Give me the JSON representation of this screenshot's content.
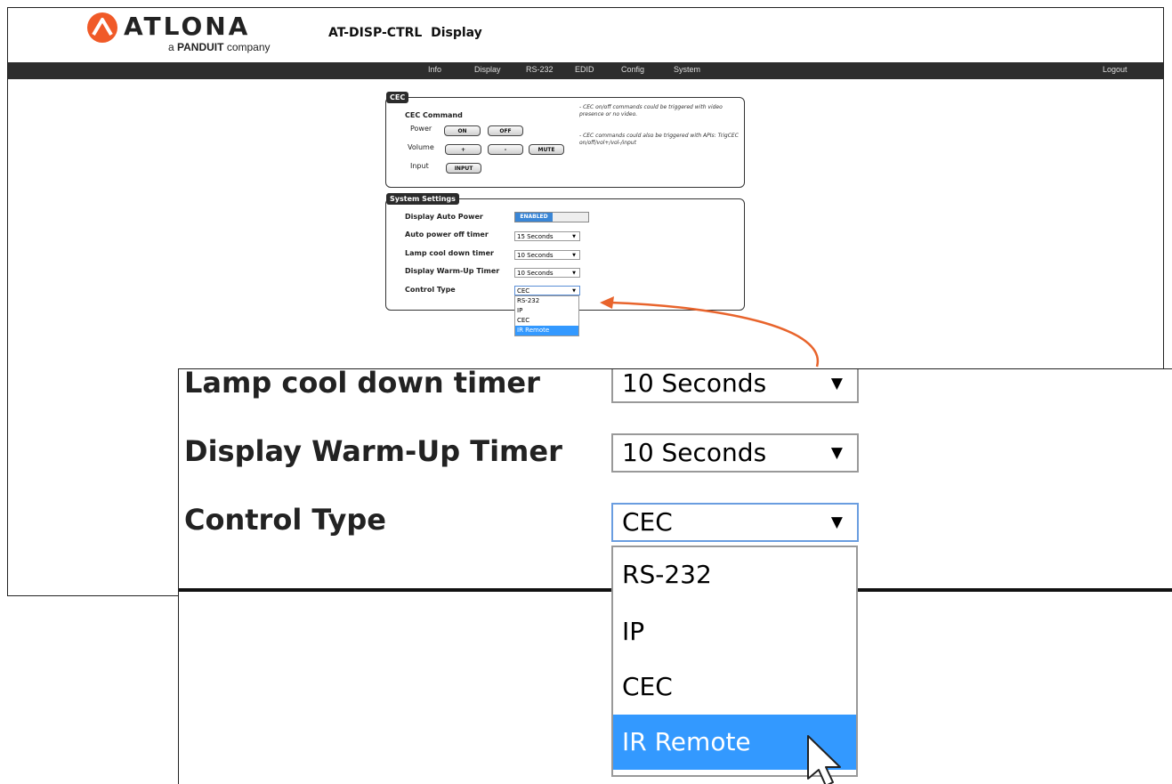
{
  "brand": {
    "logo_text": "ATLONA",
    "tagline_prefix": "a",
    "tagline_brand": "PANDUIT",
    "tagline_suffix": "company"
  },
  "header": {
    "device": "AT-DISP-CTRL",
    "page": "Display"
  },
  "nav": {
    "items": [
      "Info",
      "Display",
      "RS-232",
      "EDID",
      "Config",
      "System"
    ],
    "logout": "Logout"
  },
  "cec": {
    "legend": "CEC",
    "heading": "CEC Command",
    "power_label": "Power",
    "on": "ON",
    "off": "OFF",
    "volume_label": "Volume",
    "vol_up": "+",
    "vol_down": "-",
    "mute": "MUTE",
    "input_label": "Input",
    "input": "INPUT",
    "note1": "- CEC on/off commands could be triggered with video presence or no video.",
    "note2": "- CEC commands could also be triggered with APIs: TrigCEC on/off/vol+/vol-/input"
  },
  "system": {
    "legend": "System Settings",
    "auto_power_label": "Display Auto Power",
    "auto_power_state": "ENABLED",
    "auto_off_label": "Auto power off timer",
    "auto_off_value": "15 Seconds",
    "lamp_label": "Lamp cool down timer",
    "lamp_value": "10 Seconds",
    "warmup_label": "Display Warm-Up Timer",
    "warmup_value": "10 Seconds",
    "control_label": "Control Type",
    "control_value": "CEC",
    "control_options": [
      "RS-232",
      "IP",
      "CEC",
      "IR Remote"
    ],
    "highlighted_option": "IR Remote"
  },
  "colors": {
    "navbar": "#2d2d2d",
    "accent_blue": "#3399ff",
    "toggle_blue": "#3a86d6",
    "callout_arrow": "#e8642c"
  },
  "icons": {
    "logo": "atlona-logo-icon",
    "cursor": "mouse-pointer-icon",
    "dropdown_arrow": "caret-down-icon"
  }
}
